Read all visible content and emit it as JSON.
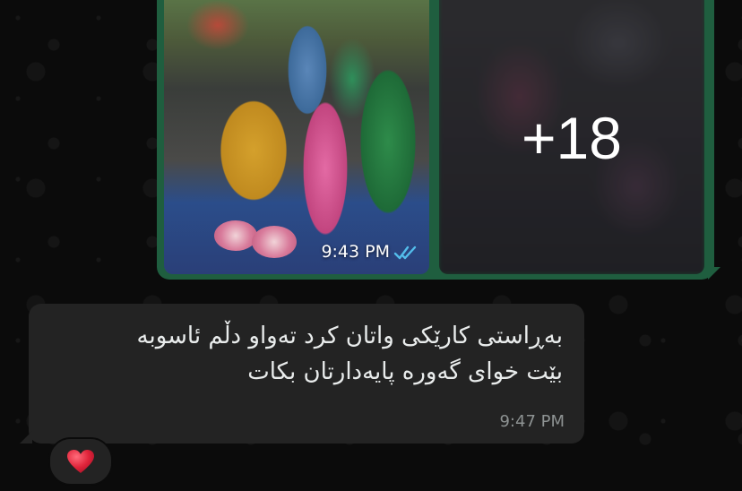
{
  "chat": {
    "outgoing_media": {
      "time": "9:43 PM",
      "read_status": "read-double-check-icon",
      "more_count": "+18",
      "bubble_color": "#1f5e3f",
      "tick_color": "#53bdeb"
    },
    "incoming_message": {
      "text": "بەڕاستی کارێکی واتان کرد تەواو دڵم ئاسوبە\nبێت خوای گەورە پایەدارتان بکات",
      "time": "9:47 PM",
      "bubble_color": "#232323"
    },
    "reaction": {
      "icon": "red-heart-icon",
      "color": "#e0243a"
    }
  }
}
